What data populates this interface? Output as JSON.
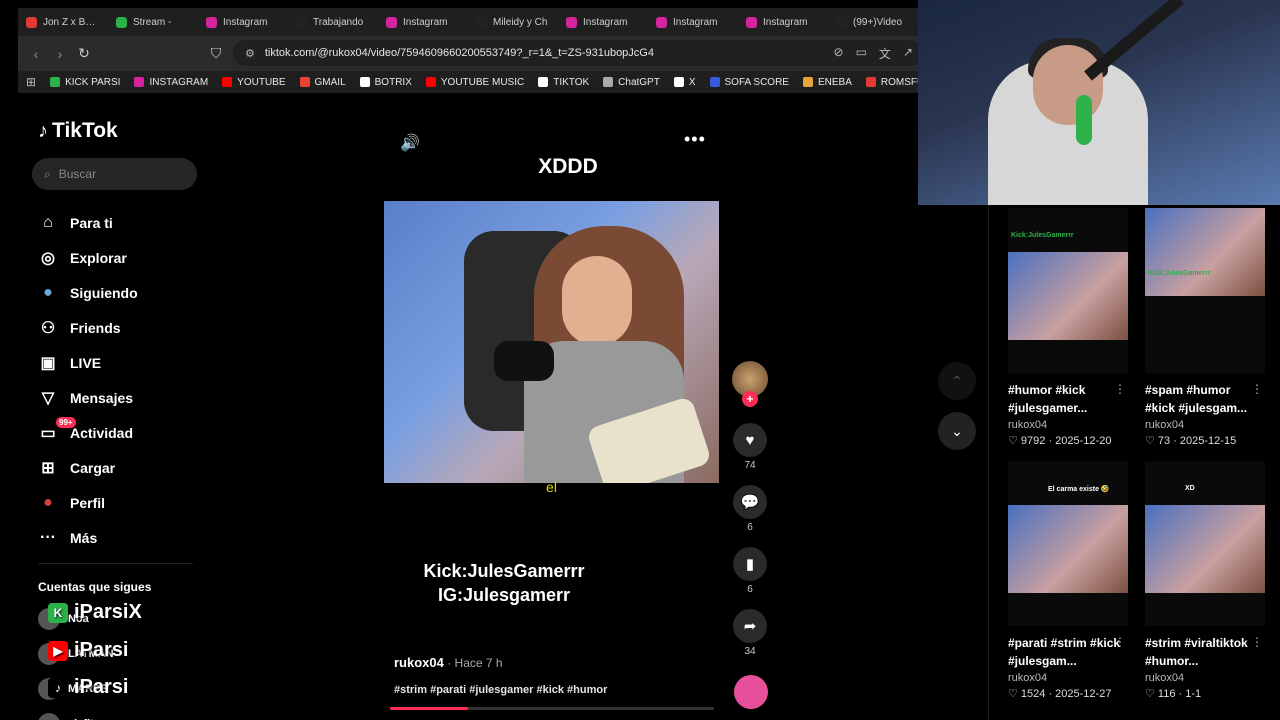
{
  "tabs": [
    {
      "label": "Jon Z x Baby",
      "color": "#e53935"
    },
    {
      "label": "Stream -",
      "color": "#2db24a"
    },
    {
      "label": "Instagram",
      "color": "#d6249f"
    },
    {
      "label": "Trabajando",
      "color": "#222222"
    },
    {
      "label": "Instagram",
      "color": "#d6249f"
    },
    {
      "label": "Mileidy y Ch",
      "color": "#222222"
    },
    {
      "label": "Instagram",
      "color": "#d6249f"
    },
    {
      "label": "Instagram",
      "color": "#d6249f"
    },
    {
      "label": "Instagram",
      "color": "#d6249f"
    },
    {
      "label": "(99+)Video",
      "color": "#222222"
    }
  ],
  "url": "tiktok.com/@rukox04/video/7594609660200553749?_r=1&_t=ZS-931ubopJcG4",
  "bookmarks": [
    {
      "label": "KICK PARSI",
      "color": "#2db24a"
    },
    {
      "label": "INSTAGRAM",
      "color": "#d6249f"
    },
    {
      "label": "YOUTUBE",
      "color": "#ff0000"
    },
    {
      "label": "GMAIL",
      "color": "#ea4335"
    },
    {
      "label": "BOTRIX",
      "color": "#ffffff"
    },
    {
      "label": "YOUTUBE MUSIC",
      "color": "#ff0000"
    },
    {
      "label": "TIKTOK",
      "color": "#ffffff"
    },
    {
      "label": "ChatGPT",
      "color": "#aaaaaa"
    },
    {
      "label": "X",
      "color": "#ffffff"
    },
    {
      "label": "SOFA SCORE",
      "color": "#3a5bd9"
    },
    {
      "label": "ENEBA",
      "color": "#e8a33a"
    },
    {
      "label": "ROMSFUN",
      "color": "#e53935"
    }
  ],
  "logo": "TikTok",
  "search_placeholder": "Buscar",
  "nav": [
    {
      "label": "Para ti",
      "icon": "home-icon",
      "glyph": "⌂"
    },
    {
      "label": "Explorar",
      "icon": "compass-icon",
      "glyph": "◎"
    },
    {
      "label": "Siguiendo",
      "icon": "following-avatar-icon",
      "glyph": "●"
    },
    {
      "label": "Friends",
      "icon": "friends-icon",
      "glyph": "⚇"
    },
    {
      "label": "LIVE",
      "icon": "live-tv-icon",
      "glyph": "▣"
    },
    {
      "label": "Mensajes",
      "icon": "messages-icon",
      "glyph": "▽"
    },
    {
      "label": "Actividad",
      "icon": "activity-icon",
      "glyph": "▭"
    },
    {
      "label": "Cargar",
      "icon": "upload-icon",
      "glyph": "⊞"
    },
    {
      "label": "Perfil",
      "icon": "profile-avatar-icon",
      "glyph": "●"
    },
    {
      "label": "Más",
      "icon": "more-dots-icon",
      "glyph": "···"
    }
  ],
  "activity_badge": "99+",
  "following_title": "Cuentas que sigues",
  "following": [
    "Noa",
    "LATMAN",
    "MARPE",
    "alefit"
  ],
  "overlay_labels": [
    "iParsiX",
    "iParsi",
    "iParsi"
  ],
  "caption_top": "XDDD",
  "subtitle": "el",
  "caption_mid_1": "Kick:JulesGamerrr",
  "caption_mid_2": "IG:Julesgamerr",
  "author": "rukox04",
  "time": " · Hace 7 h",
  "tags": "#strim #parati #julesgamer #kick #humor",
  "progress": 0.24,
  "likes": "74",
  "comments": "6",
  "saves": "6",
  "shares": "34",
  "related": [
    {
      "title": "#humor #kick #julesgamer...",
      "user": "rukox04",
      "stats": "♡ 9792 · 2025-12-20",
      "thumb_text": "Kick:JulesGamerrr"
    },
    {
      "title": "#spam #humor #kick #julesgam...",
      "user": "rukox04",
      "stats": "♡ 73 · 2025-12-15",
      "thumb_text": "Kick:JulesGamerrr"
    },
    {
      "title": "#parati #strim #kick #julesgam...",
      "user": "rukox04",
      "stats": "♡ 1524 · 2025-12-27",
      "thumb_text": "El carma existe 🤣"
    },
    {
      "title": "#strim #viraltiktok #humor...",
      "user": "rukox04",
      "stats": "♡ 116 · 1-1",
      "thumb_text": "XD"
    }
  ]
}
